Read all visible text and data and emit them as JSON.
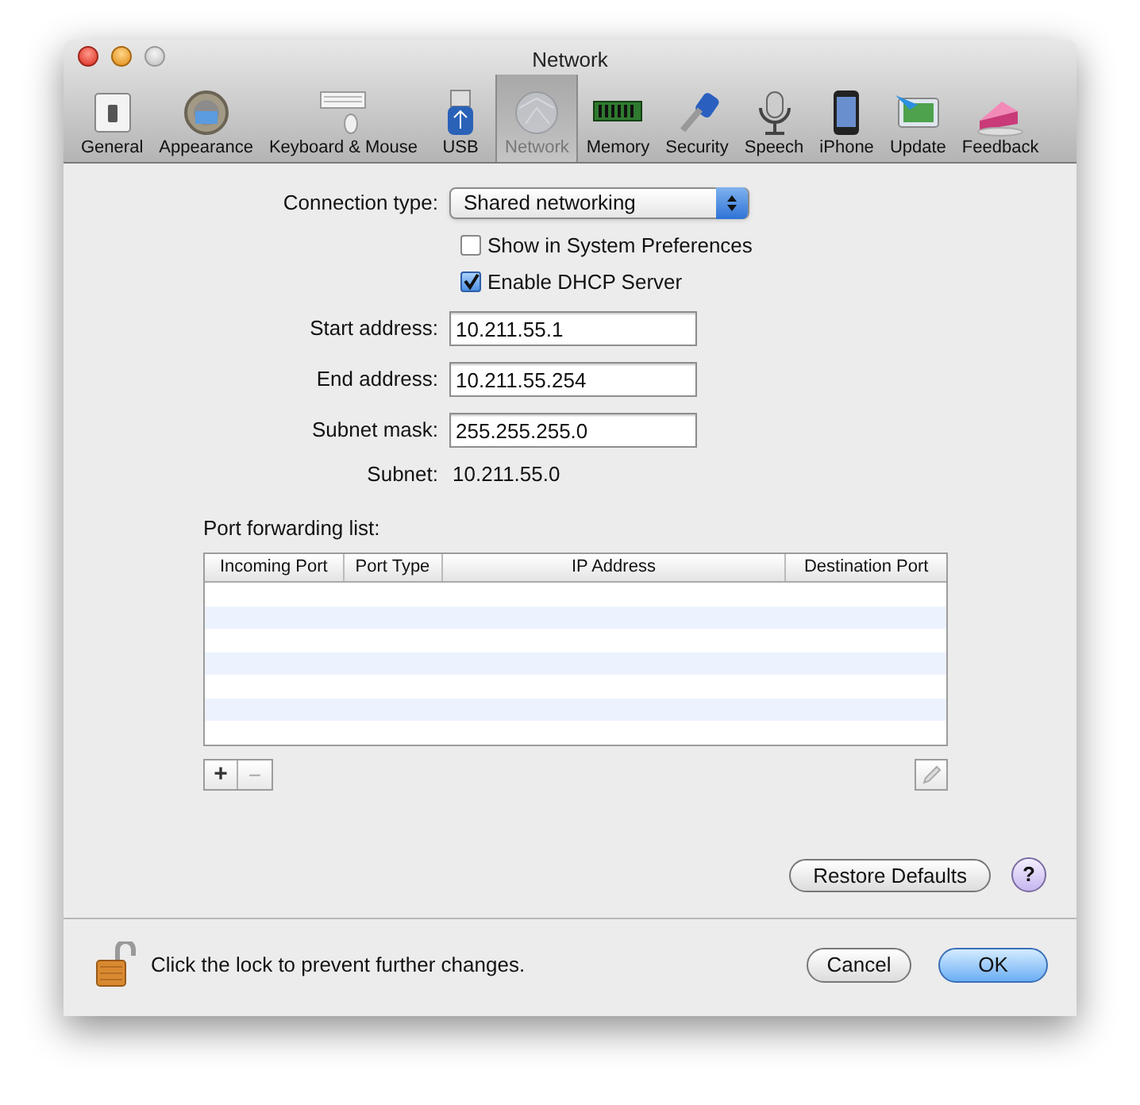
{
  "window": {
    "title": "Network"
  },
  "toolbar": [
    {
      "label": "General",
      "selected": false
    },
    {
      "label": "Appearance",
      "selected": false
    },
    {
      "label": "Keyboard & Mouse",
      "selected": false
    },
    {
      "label": "USB",
      "selected": false
    },
    {
      "label": "Network",
      "selected": true
    },
    {
      "label": "Memory",
      "selected": false
    },
    {
      "label": "Security",
      "selected": false
    },
    {
      "label": "Speech",
      "selected": false
    },
    {
      "label": "iPhone",
      "selected": false
    },
    {
      "label": "Update",
      "selected": false
    },
    {
      "label": "Feedback",
      "selected": false
    }
  ],
  "connection_type": {
    "label": "Connection type:",
    "value": "Shared networking"
  },
  "checkboxes": [
    {
      "label": "Show in System Preferences",
      "checked": false
    },
    {
      "label": "Enable DHCP Server",
      "checked": true
    }
  ],
  "fields": [
    {
      "label": "Start address:",
      "value": "10.211.55.1"
    },
    {
      "label": "End address:",
      "value": "10.211.55.254"
    },
    {
      "label": "Subnet mask:",
      "value": "255.255.255.0"
    }
  ],
  "subnet": {
    "label": "Subnet:",
    "value": "10.211.55.0"
  },
  "port_forwarding": {
    "label": "Port forwarding list:",
    "columns": [
      "Incoming Port",
      "Port Type",
      "IP Address",
      "Destination Port"
    ],
    "add_button": "+",
    "remove_button": "−"
  },
  "restore_defaults": "Restore Defaults",
  "help": "?",
  "lock_text": "Click the lock to prevent further changes.",
  "buttons": {
    "cancel": "Cancel",
    "ok": "OK"
  }
}
